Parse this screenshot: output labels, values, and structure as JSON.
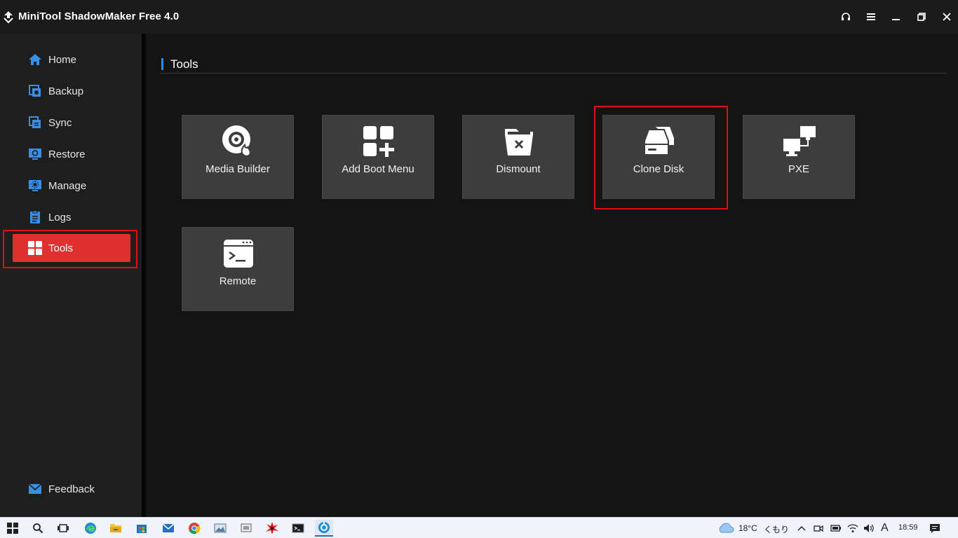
{
  "window": {
    "title": "MiniTool ShadowMaker Free 4.0"
  },
  "titlebar_buttons": [
    "headset-icon",
    "menu-icon",
    "minimize-icon",
    "restore-icon",
    "close-icon"
  ],
  "sidebar": {
    "items": [
      {
        "label": "Home",
        "icon": "home-icon",
        "active": false
      },
      {
        "label": "Backup",
        "icon": "backup-icon",
        "active": false
      },
      {
        "label": "Sync",
        "icon": "sync-icon",
        "active": false
      },
      {
        "label": "Restore",
        "icon": "restore-icon",
        "active": false
      },
      {
        "label": "Manage",
        "icon": "manage-icon",
        "active": false
      },
      {
        "label": "Logs",
        "icon": "logs-icon",
        "active": false
      },
      {
        "label": "Tools",
        "icon": "tools-icon",
        "active": true
      }
    ],
    "feedback": {
      "label": "Feedback",
      "icon": "mail-icon"
    }
  },
  "main": {
    "section_title": "Tools",
    "tiles": [
      {
        "label": "Media Builder",
        "icon": "media-builder-icon"
      },
      {
        "label": "Add Boot Menu",
        "icon": "add-boot-menu-icon"
      },
      {
        "label": "Dismount",
        "icon": "dismount-icon"
      },
      {
        "label": "Clone Disk",
        "icon": "clone-disk-icon",
        "highlighted": true
      },
      {
        "label": "PXE",
        "icon": "pxe-icon"
      },
      {
        "label": "Remote",
        "icon": "remote-icon"
      }
    ]
  },
  "taskbar": {
    "apps": [
      "windows-start-icon",
      "search-icon",
      "task-view-icon",
      "edge-icon",
      "file-explorer-icon",
      "store-icon",
      "mail-icon",
      "chrome-icon",
      "photos-icon",
      "snipping-icon",
      "paint-icon",
      "cmd-icon",
      "shadowmaker-icon"
    ],
    "weather_temp": "18°C",
    "weather_text": "くもり",
    "ime": "A",
    "time": "18:59"
  },
  "colors": {
    "accent_red": "#e03131",
    "highlight_red": "#e01010",
    "header_bar_blue": "#2f8be0",
    "tile_bg": "#3d3d3d",
    "icon_blue": "#3a8ee6"
  }
}
